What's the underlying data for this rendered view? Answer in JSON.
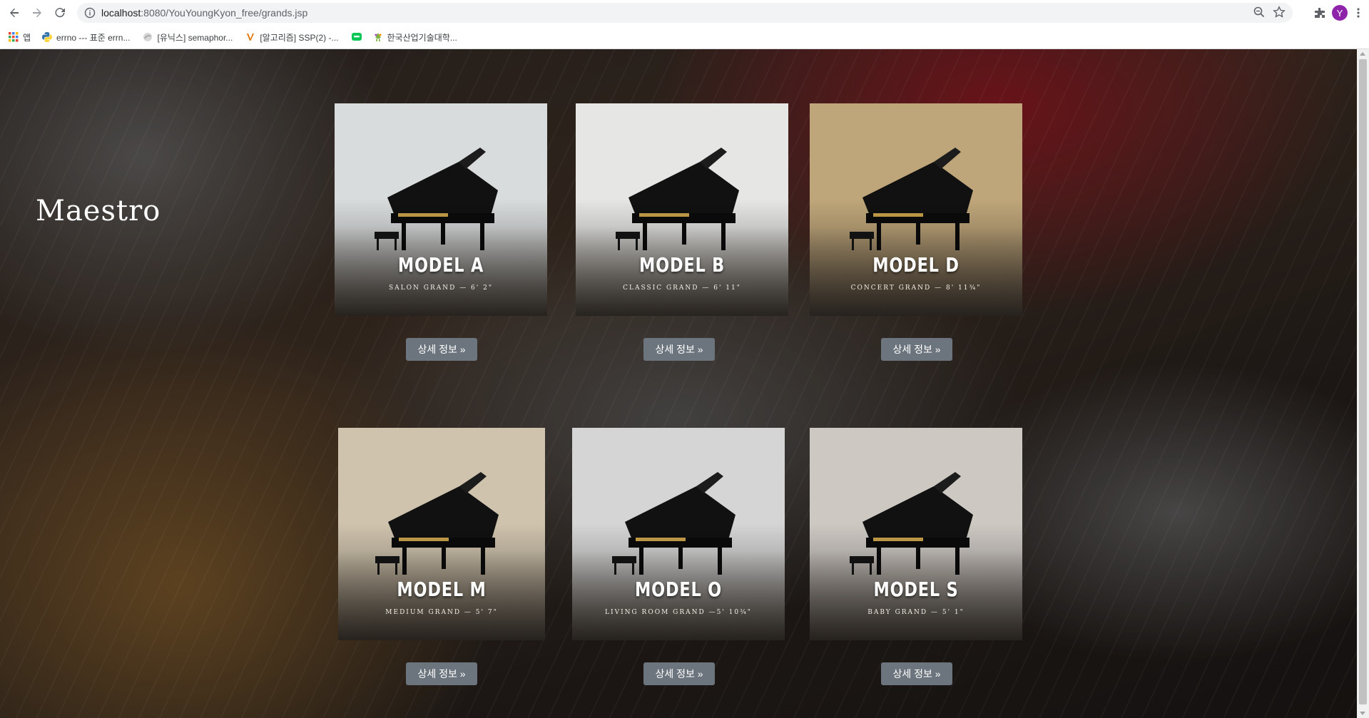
{
  "browser": {
    "url_host": "localhost",
    "url_rest": ":8080/YouYoungKyon_free/grands.jsp",
    "profile_initial": "Y"
  },
  "bookmarks": [
    {
      "label": "앱",
      "icon": "apps-grid-icon"
    },
    {
      "label": "errno --- 표준 errn...",
      "icon": "python-icon"
    },
    {
      "label": "[유닉스] semaphor...",
      "icon": "bookmark-page-icon"
    },
    {
      "label": "[알고리즘] SSP(2) -...",
      "icon": "velog-icon"
    },
    {
      "label": "",
      "icon": "line-chat-icon"
    },
    {
      "label": "한국산업기술대학...",
      "icon": "university-icon"
    }
  ],
  "page": {
    "brand": "Maestro",
    "detail_button_label": "상세 정보 »",
    "models": [
      {
        "name": "MODEL A",
        "subtitle": "SALON GRAND — 6' 2\"",
        "room_color": "#d9dcdc"
      },
      {
        "name": "MODEL B",
        "subtitle": "CLASSIC GRAND — 6' 11\"",
        "room_color": "#e6e6e4"
      },
      {
        "name": "MODEL D",
        "subtitle": "CONCERT GRAND — 8' 11¾\"",
        "room_color": "#bfa67a"
      },
      {
        "name": "MODEL M",
        "subtitle": "MEDIUM GRAND — 5' 7\"",
        "room_color": "#cfc3ad"
      },
      {
        "name": "MODEL O",
        "subtitle": "LIVING ROOM GRAND —5' 10¾\"",
        "room_color": "#d5d5d5"
      },
      {
        "name": "MODEL S",
        "subtitle": "BABY GRAND — 5' 1\"",
        "room_color": "#cdc8c2"
      }
    ]
  }
}
